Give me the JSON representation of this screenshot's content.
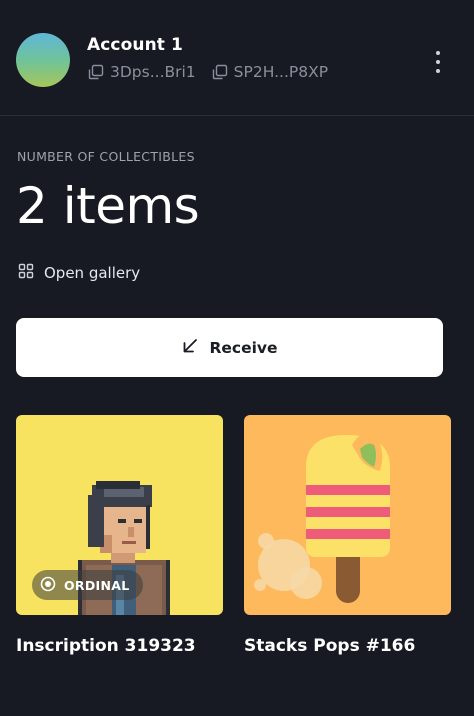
{
  "account": {
    "name": "Account 1",
    "addresses": [
      "3Dps...Bri1",
      "SP2H...P8XP"
    ]
  },
  "collectibles": {
    "label": "NUMBER OF COLLECTIBLES",
    "count": "2 items",
    "gallery_link": "Open gallery",
    "receive_label": "Receive"
  },
  "items": [
    {
      "title": "Inscription 319323",
      "badge": "ORDINAL"
    },
    {
      "title": "Stacks Pops #166"
    }
  ],
  "icons": [
    "copy-icon",
    "more-vertical-icon",
    "grid-icon",
    "arrow-down-left-icon",
    "ordinal-icon"
  ],
  "colors": {
    "background": "#171923",
    "button_bg": "#ffffff",
    "card1_bg": "#f7e360",
    "card2_bg": "#fdb95c"
  }
}
